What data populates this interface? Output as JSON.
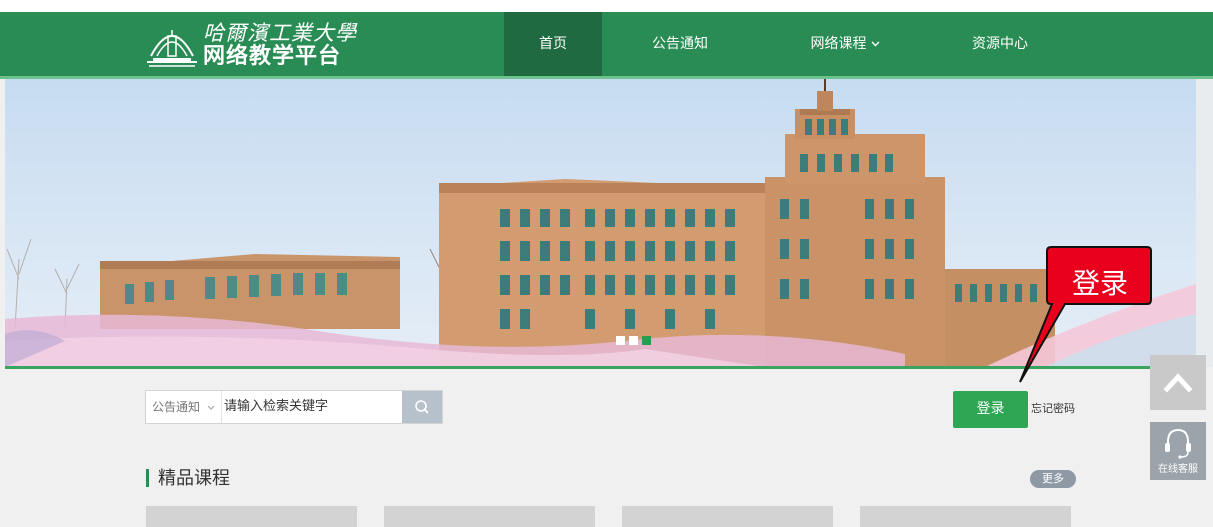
{
  "header": {
    "logo_line1": "哈爾濱工業大學",
    "logo_line2": "网络教学平台",
    "nav": [
      {
        "label": "首页",
        "active": true
      },
      {
        "label": "公告通知"
      },
      {
        "label": "网络课程",
        "has_dropdown": true
      },
      {
        "label": "资源中心"
      }
    ]
  },
  "banner": {
    "dot_count": 3,
    "active_dot": 3
  },
  "search": {
    "scope_label": "公告通知",
    "placeholder": "请输入检索关键字"
  },
  "login": {
    "button_label": "登录",
    "forgot_label": "忘记密码",
    "callout_label": "登录"
  },
  "section": {
    "title": "精品课程",
    "more_label": "更多"
  },
  "floats": {
    "service_label": "在线客服"
  },
  "colors": {
    "header_green": "#2a8c55",
    "nav_active": "#1f6a40",
    "button_green": "#2fa654",
    "callout_red": "#e8001c"
  }
}
